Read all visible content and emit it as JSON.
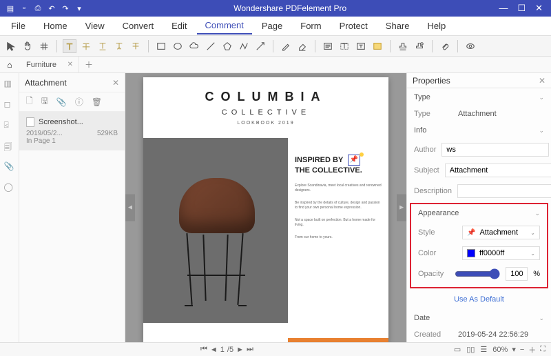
{
  "app": {
    "title": "Wondershare PDFelement Pro"
  },
  "menu": [
    "File",
    "Home",
    "View",
    "Convert",
    "Edit",
    "Comment",
    "Page",
    "Form",
    "Protect",
    "Share",
    "Help"
  ],
  "menu_active": "Comment",
  "tabs": {
    "items": [
      {
        "label": "Furniture"
      }
    ]
  },
  "attach_panel": {
    "title": "Attachment",
    "item": {
      "name": "Screenshot...",
      "date": "2019/05/2...",
      "size": "529KB",
      "page": "In Page 1"
    }
  },
  "doc": {
    "brand_title": "COLUMBIA",
    "brand_sub": "COLLECTIVE",
    "brand_tag": "LOOKBOOK 2019",
    "headline1": "INSPIRED BY",
    "headline2": "THE COLLECTIVE.",
    "p1": "Explore Scandinavia, meet local creatives and renowned designers.",
    "p2": "Be inspired by the details of culture, design and passion to find your own personal home expression.",
    "p3": "Not a space built on perfection. But a home made for living.",
    "p4": "From our home to yours."
  },
  "props": {
    "title": "Properties",
    "sec_type": "Type",
    "type_label": "Type",
    "type_value": "Attachment",
    "sec_info": "Info",
    "author_label": "Author",
    "author_value": "ws",
    "subject_label": "Subject",
    "subject_value": "Attachment",
    "desc_label": "Description",
    "desc_value": "",
    "sec_appearance": "Appearance",
    "style_label": "Style",
    "style_value": "Attachment",
    "color_label": "Color",
    "color_value": "ff0000ff",
    "opacity_label": "Opacity",
    "opacity_value": "100",
    "opacity_unit": "%",
    "use_default": "Use As Default",
    "sec_date": "Date",
    "created_label": "Created",
    "created_value": "2019-05-24 22:56:29"
  },
  "status": {
    "page_current": "1",
    "page_sep": "/5",
    "zoom": "60%"
  }
}
